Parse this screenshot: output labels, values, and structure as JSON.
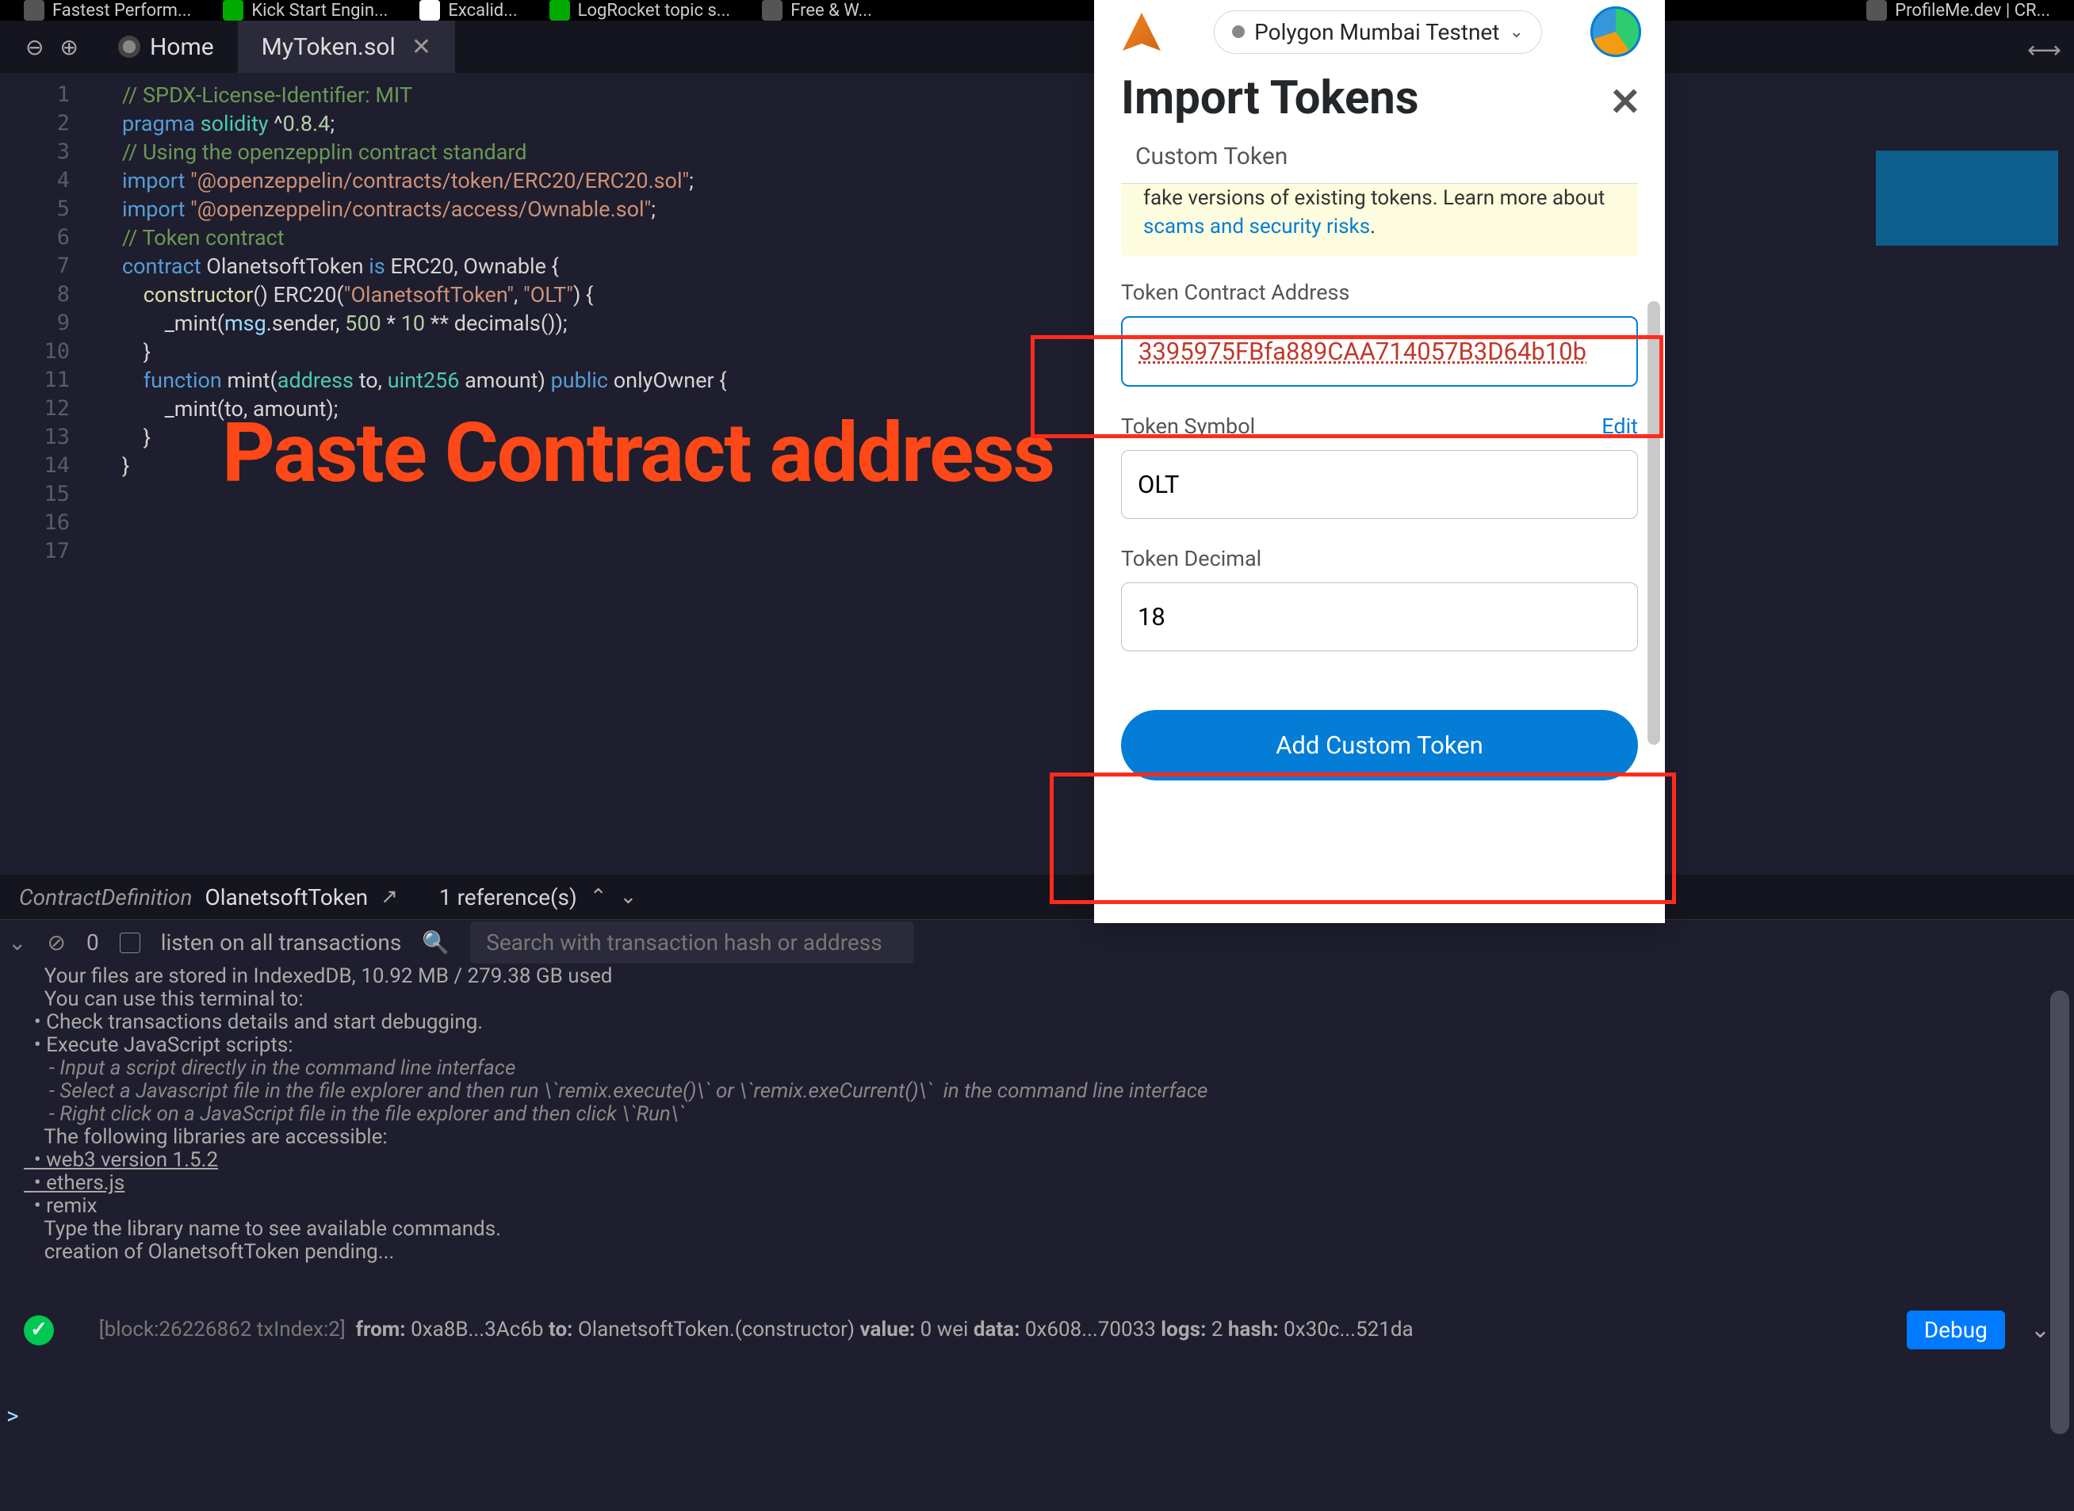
{
  "bookmarks": [
    {
      "label": "Fastest Perform..."
    },
    {
      "label": "Kick Start Engin..."
    },
    {
      "label": "Excalid..."
    },
    {
      "label": "LogRocket topic s..."
    },
    {
      "label": "Free & W..."
    },
    {
      "label": "ProfileMe.dev | CR..."
    }
  ],
  "tabs": {
    "home": "Home",
    "file": "MyToken.sol"
  },
  "code": {
    "lines": [
      {
        "n": "1",
        "parts": [
          [
            "comment",
            "// SPDX-License-Identifier: MIT"
          ]
        ]
      },
      {
        "n": "2",
        "parts": [
          [
            "keyword",
            "pragma"
          ],
          [
            "punct",
            " "
          ],
          [
            "type",
            "solidity"
          ],
          [
            "punct",
            " ^"
          ],
          [
            "number",
            "0.8.4"
          ],
          [
            "punct",
            ";"
          ]
        ]
      },
      {
        "n": "3",
        "parts": []
      },
      {
        "n": "4",
        "parts": [
          [
            "comment",
            "// Using the openzepplin contract standard"
          ]
        ]
      },
      {
        "n": "5",
        "parts": [
          [
            "keyword",
            "import"
          ],
          [
            "punct",
            " "
          ],
          [
            "string",
            "\"@openzeppelin/contracts/token/ERC20/ERC20.sol\""
          ],
          [
            "punct",
            ";"
          ]
        ]
      },
      {
        "n": "6",
        "parts": [
          [
            "keyword",
            "import"
          ],
          [
            "punct",
            " "
          ],
          [
            "string",
            "\"@openzeppelin/contracts/access/Ownable.sol\""
          ],
          [
            "punct",
            ";"
          ]
        ]
      },
      {
        "n": "7",
        "parts": []
      },
      {
        "n": "8",
        "parts": [
          [
            "comment",
            "// Token contract"
          ]
        ]
      },
      {
        "n": "9",
        "parts": [
          [
            "keyword",
            "contract"
          ],
          [
            "punct",
            " OlanetsoftToken "
          ],
          [
            "keyword",
            "is"
          ],
          [
            "punct",
            " ERC20, Ownable {"
          ]
        ]
      },
      {
        "n": "10",
        "parts": [
          [
            "punct",
            "    "
          ],
          [
            "func",
            "constructor"
          ],
          [
            "punct",
            "() ERC20("
          ],
          [
            "string",
            "\"OlanetsoftToken\""
          ],
          [
            "punct",
            ", "
          ],
          [
            "string",
            "\"OLT\""
          ],
          [
            "punct",
            ") {"
          ]
        ]
      },
      {
        "n": "11",
        "parts": [
          [
            "punct",
            "        _mint("
          ],
          [
            "var",
            "msg"
          ],
          [
            "punct",
            ".sender, "
          ],
          [
            "number",
            "500"
          ],
          [
            "punct",
            " * "
          ],
          [
            "number",
            "10"
          ],
          [
            "punct",
            " ** decimals());"
          ]
        ]
      },
      {
        "n": "12",
        "parts": [
          [
            "punct",
            "    }"
          ]
        ]
      },
      {
        "n": "13",
        "parts": []
      },
      {
        "n": "14",
        "parts": [
          [
            "punct",
            "    "
          ],
          [
            "keyword",
            "function"
          ],
          [
            "punct",
            " mint("
          ],
          [
            "type",
            "address"
          ],
          [
            "punct",
            " to, "
          ],
          [
            "type",
            "uint256"
          ],
          [
            "punct",
            " amount) "
          ],
          [
            "keyword",
            "public"
          ],
          [
            "punct",
            " onlyOwner {"
          ]
        ]
      },
      {
        "n": "15",
        "parts": [
          [
            "punct",
            "        _mint(to, amount);"
          ]
        ]
      },
      {
        "n": "16",
        "parts": [
          [
            "punct",
            "    }"
          ]
        ]
      },
      {
        "n": "17",
        "parts": [
          [
            "punct",
            "}"
          ]
        ]
      }
    ]
  },
  "annotation": "Paste Contract address",
  "breadcrumb": {
    "type": "ContractDefinition",
    "name": "OlanetsoftToken",
    "refs": "1 reference(s)"
  },
  "debug": {
    "count": "0",
    "listen": "listen on all transactions",
    "search_placeholder": "Search with transaction hash or address"
  },
  "terminal": {
    "lines": [
      "    Your files are stored in IndexedDB, 10.92 MB / 279.38 GB used",
      "",
      "    You can use this terminal to:",
      "  • Check transactions details and start debugging.",
      "  • Execute JavaScript scripts:",
      "     - Input a script directly in the command line interface",
      "     - Select a Javascript file in the file explorer and then run \\`remix.execute()\\` or \\`remix.exeCurrent()\\`  in the command line interface",
      "     - Right click on a JavaScript file in the file explorer and then click \\`Run\\`",
      "",
      "    The following libraries are accessible:",
      "  • web3 version 1.5.2",
      "  • ethers.js",
      "  • remix",
      "",
      "    Type the library name to see available commands.",
      "    creation of OlanetsoftToken pending..."
    ],
    "links": [
      10,
      11
    ]
  },
  "tx": {
    "block": "[block:26226862 txIndex:2]",
    "from_label": "from:",
    "from": "0xa8B...3Ac6b",
    "to_label": "to:",
    "to": "OlanetsoftToken.(constructor)",
    "value_label": "value:",
    "value": "0 wei",
    "data_label": "data:",
    "data": "0x608...70033",
    "logs_label": "logs:",
    "logs": "2",
    "hash_label": "hash:",
    "hash": "0x30c...521da",
    "debug_btn": "Debug"
  },
  "prompt": ">",
  "metamask": {
    "network": "Polygon Mumbai Testnet",
    "title": "Import Tokens",
    "tab": "Custom Token",
    "warning_prefix": "fake versions of existing tokens. Learn more about ",
    "warning_link": "scams and security risks",
    "warning_suffix": ".",
    "address_label": "Token Contract Address",
    "address_value": "3395975FBfa889CAA714057B3D64b10b",
    "symbol_label": "Token Symbol",
    "symbol_edit": "Edit",
    "symbol_value": "OLT",
    "decimal_label": "Token Decimal",
    "decimal_value": "18",
    "button": "Add Custom Token"
  }
}
